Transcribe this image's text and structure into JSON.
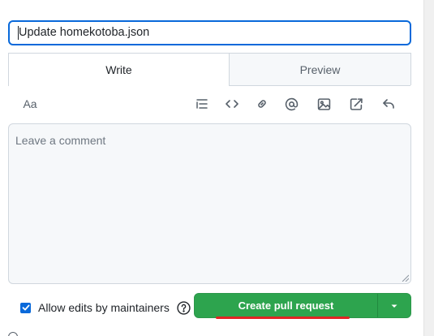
{
  "title_field": {
    "value": "Update homekotoba.json"
  },
  "tabs": [
    {
      "label": "Write",
      "active": true
    },
    {
      "label": "Preview",
      "active": false
    }
  ],
  "toolbar": {
    "text_size_label": "Aa",
    "icons": [
      "heading-list-icon",
      "code-icon",
      "link-icon",
      "mention-icon",
      "image-icon",
      "cross-reference-icon",
      "reply-icon"
    ]
  },
  "comment": {
    "placeholder": "Leave a comment",
    "value": ""
  },
  "allow_edits": {
    "label": "Allow edits by maintainers",
    "checked": true
  },
  "create_button": {
    "label": "Create pull request",
    "color": "#2da44e"
  },
  "colors": {
    "accent": "#0969da",
    "highlight_underline": "#e02424"
  }
}
